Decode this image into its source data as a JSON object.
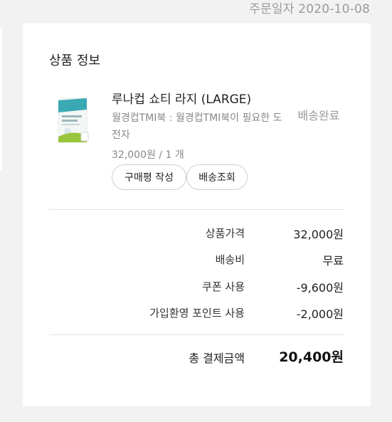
{
  "header": {
    "order_date": "주문일자 2020-10-08"
  },
  "product_section": {
    "title": "상품 정보",
    "item": {
      "name": "루나컵 쇼티 라지 (LARGE)",
      "option": "월경컵TMI북 : 월경컵TMI북이 필요한 도전자",
      "price_qty": "32,000원 / 1 개",
      "status": "배송완료",
      "thumbnail_icon": "product-package-icon",
      "actions": {
        "review_label": "구매평 작성",
        "track_label": "배송조회"
      }
    }
  },
  "summary": {
    "rows": [
      {
        "label": "상품가격",
        "value": "32,000원"
      },
      {
        "label": "배송비",
        "value": "무료"
      },
      {
        "label": "쿠폰 사용",
        "value": "-9,600원"
      },
      {
        "label": "가입환영 포인트 사용",
        "value": "-2,000원"
      }
    ],
    "total_label": "총 결제금액",
    "total_value": "20,400원"
  },
  "colors": {
    "background": "#f2f2f2",
    "card": "#ffffff",
    "muted_text": "#888888",
    "border": "#cfcfcf"
  }
}
